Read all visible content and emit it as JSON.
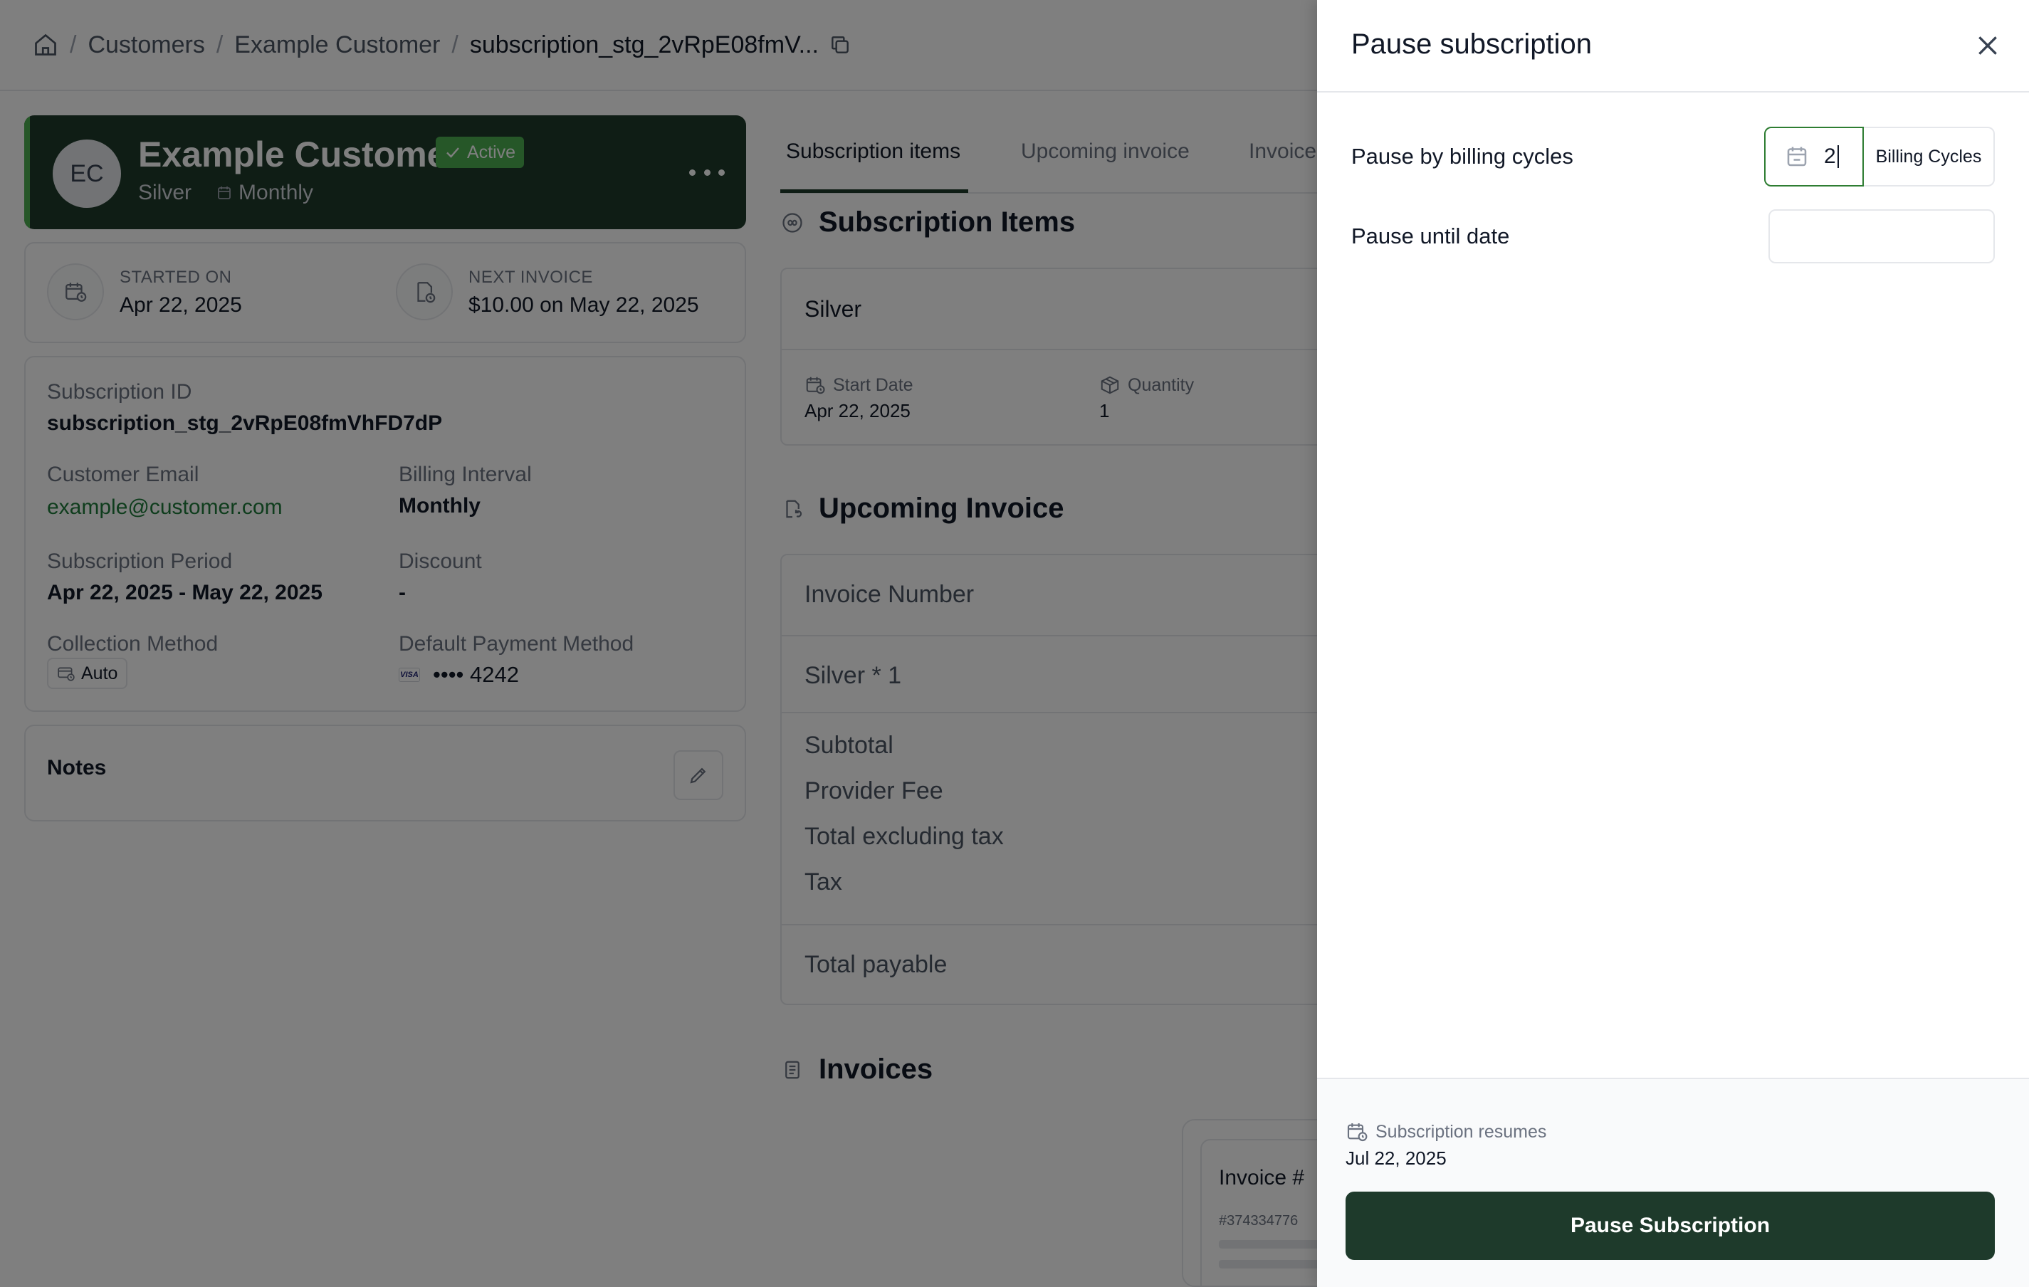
{
  "breadcrumb": {
    "home_icon": "home-icon",
    "items": [
      "Customers",
      "Example Customer"
    ],
    "current": "subscription_stg_2vRpE08fmV...",
    "copy_icon": "copy-icon"
  },
  "customer": {
    "initials": "EC",
    "name": "Example Customer",
    "status": "Active",
    "plan": "Silver",
    "interval": "Monthly"
  },
  "stats": {
    "started_label": "STARTED ON",
    "started_value": "Apr 22, 2025",
    "next_label": "NEXT INVOICE",
    "next_value": "$10.00 on May 22, 2025"
  },
  "details": {
    "sub_id_label": "Subscription ID",
    "sub_id_value": "subscription_stg_2vRpE08fmVhFD7dP",
    "email_label": "Customer Email",
    "email_value": "example@customer.com",
    "interval_label": "Billing Interval",
    "interval_value": "Monthly",
    "period_label": "Subscription Period",
    "period_value": "Apr 22, 2025 - May 22, 2025",
    "discount_label": "Discount",
    "discount_value": "-",
    "collection_label": "Collection Method",
    "collection_value": "Auto",
    "payment_label": "Default Payment Method",
    "card_brand": "VISA",
    "card_value": "•••• 4242"
  },
  "notes": {
    "title": "Notes"
  },
  "tabs": [
    "Subscription items",
    "Upcoming invoice",
    "Invoices"
  ],
  "subscription_items": {
    "title": "Subscription Items",
    "item_name": "Silver",
    "start_label": "Start Date",
    "start_value": "Apr 22, 2025",
    "qty_label": "Quantity",
    "qty_value": "1"
  },
  "upcoming_invoice": {
    "title": "Upcoming Invoice",
    "number_label": "Invoice Number",
    "line_item": "Silver * 1",
    "subtotal": "Subtotal",
    "provider_fee": "Provider Fee",
    "total_ex_tax": "Total excluding tax",
    "tax": "Tax",
    "total_payable": "Total payable"
  },
  "invoices": {
    "title": "Invoices",
    "card_title": "Invoice #",
    "card_number": "#374334776"
  },
  "drawer": {
    "title": "Pause subscription",
    "cycles_label": "Pause by billing cycles",
    "cycles_value": "2",
    "cycles_addon": "Billing Cycles",
    "until_label": "Pause until date",
    "until_value": "",
    "resume_label": "Subscription resumes",
    "resume_date": "Jul 22, 2025",
    "submit_label": "Pause Subscription"
  },
  "colors": {
    "brand_dark": "#1e3a2b",
    "accent_green": "#4caf50",
    "link_green": "#1f7a3a",
    "overlay": "rgba(0,0,0,0.5)"
  }
}
